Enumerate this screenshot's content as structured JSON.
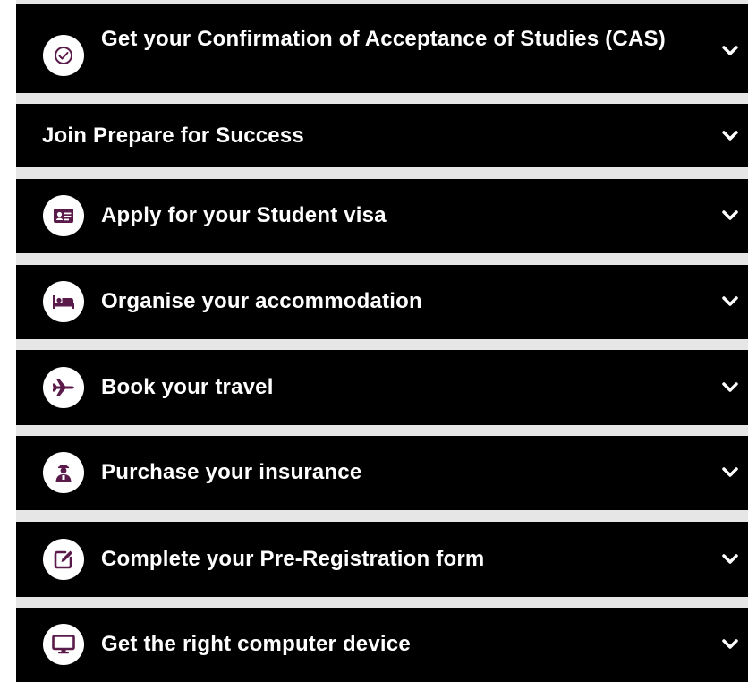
{
  "accordion": {
    "items": [
      {
        "label": "Get your Confirmation of Acceptance of Studies (CAS)",
        "icon": "check-circle-icon"
      },
      {
        "label": "Join Prepare for Success",
        "icon": ""
      },
      {
        "label": "Apply for your Student visa",
        "icon": "id-card-icon"
      },
      {
        "label": "Organise your accommodation",
        "icon": "bed-icon"
      },
      {
        "label": "Book your travel",
        "icon": "plane-icon"
      },
      {
        "label": "Purchase your insurance",
        "icon": "person-icon"
      },
      {
        "label": "Complete your Pre-Registration form",
        "icon": "edit-form-icon"
      },
      {
        "label": "Get the right computer device",
        "icon": "monitor-icon"
      }
    ]
  },
  "colors": {
    "row_background": "#000000",
    "gap_background": "#e6e6e6",
    "icon_color": "#5a1a4a",
    "text": "#ffffff"
  }
}
